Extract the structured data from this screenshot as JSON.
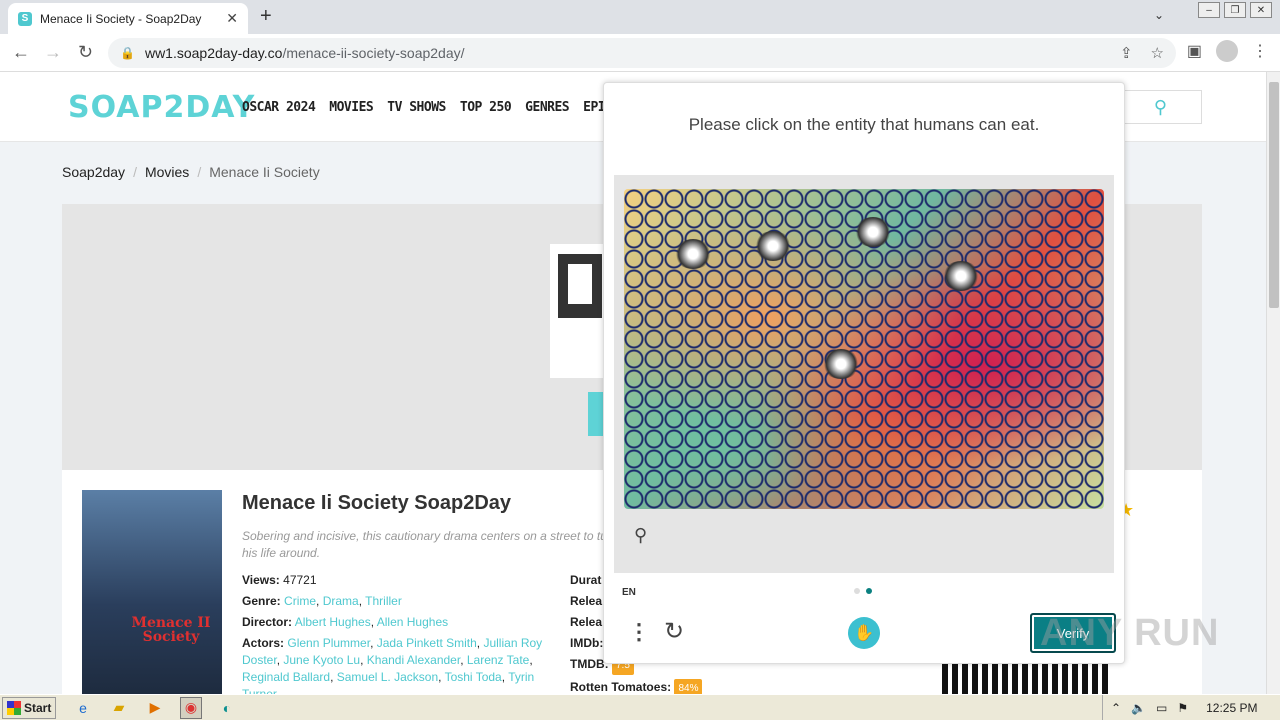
{
  "browser": {
    "tab_title": "Menace Ii Society - Soap2Day",
    "tab_favicon_letter": "S",
    "url_host": "ww1.soap2day-day.co",
    "url_path": "/menace-ii-society-soap2day/"
  },
  "site": {
    "logo": "SOAP2DAY",
    "nav": [
      "OSCAR 2024",
      "MOVIES",
      "TV SHOWS",
      "TOP 250",
      "GENRES",
      "EPISODE"
    ]
  },
  "breadcrumb": {
    "home": "Soap2day",
    "section": "Movies",
    "current": "Menace Ii Society"
  },
  "movie": {
    "title": "Menace Ii Society Soap2Day",
    "description": "Sobering and incisive, this cautionary drama centers on a street to\nturn his life around.",
    "poster_text": "Menace II Society",
    "views_label": "Views:",
    "views": "47721",
    "genre_label": "Genre:",
    "genres": [
      "Crime",
      "Drama",
      "Thriller"
    ],
    "director_label": "Director:",
    "directors": [
      "Albert Hughes",
      "Allen Hughes"
    ],
    "actors_label": "Actors:",
    "actors": [
      "Glenn Plummer",
      "Jada Pinkett Smith",
      "Jullian Roy Doster",
      "June Kyoto Lu",
      "Khandi Alexander",
      "Larenz Tate",
      "Reginald Ballard",
      "Samuel L. Jackson",
      "Toshi Toda",
      "Tyrin Turner"
    ],
    "right_labels": [
      "Durat",
      "Relea",
      "Relea",
      "IMDb:"
    ],
    "tmdb_label": "TMDB:",
    "tmdb_value": "7.5",
    "rt_label": "Rotten Tomatoes:",
    "rt_value": "84%"
  },
  "captcha": {
    "prompt": "Please click on the entity that humans can eat.",
    "language": "EN",
    "verify_label": "Verify",
    "page_dots": [
      false,
      true
    ]
  },
  "watermark": "ANY RUN",
  "taskbar": {
    "start_label": "Start",
    "clock": "12:25 PM"
  },
  "colors": {
    "brand_teal": "#5ed3d6",
    "verify_bg": "#0a7f85",
    "rating_badge": "#f5a623"
  }
}
